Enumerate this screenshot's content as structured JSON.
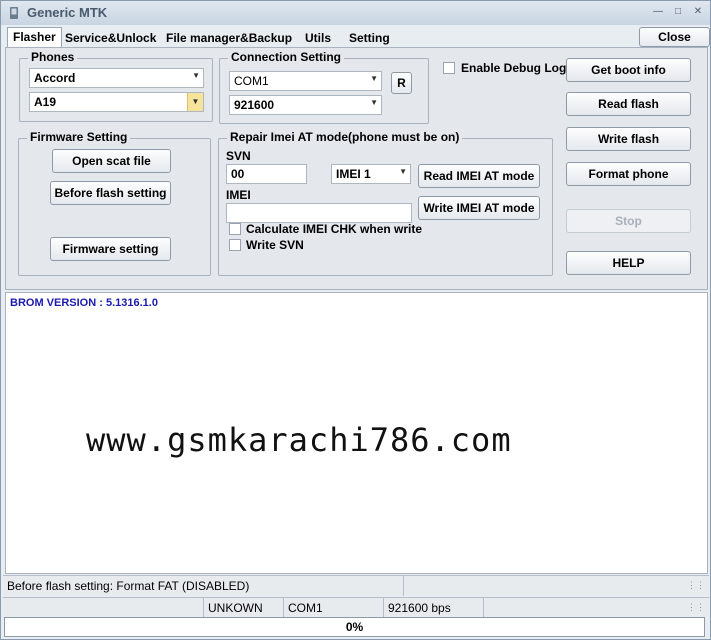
{
  "window": {
    "title": "Generic MTK"
  },
  "tabs": [
    {
      "label": "Flasher",
      "active": true
    },
    {
      "label": "Service&Unlock"
    },
    {
      "label": "File manager&Backup"
    },
    {
      "label": "Utils"
    },
    {
      "label": "Setting"
    }
  ],
  "close_label": "Close",
  "phones": {
    "title": "Phones",
    "brand": "Accord",
    "model": "A19"
  },
  "connection": {
    "title": "Connection Setting",
    "port": "COM1",
    "baud": "921600",
    "refresh_label": "R"
  },
  "debug": {
    "label": "Enable Debug Log",
    "checked": false
  },
  "firmware": {
    "title": "Firmware Setting",
    "open_scat": "Open scat file",
    "before_flash": "Before flash setting",
    "firmware_setting": "Firmware setting"
  },
  "imei": {
    "title": "Repair Imei AT mode(phone must be on)",
    "svn_label": "SVN",
    "svn_value": "00",
    "slot": "IMEI 1",
    "read_btn": "Read IMEI AT mode",
    "imei_label": "IMEI",
    "imei_value": "",
    "write_btn": "Write IMEI AT mode",
    "calc_chk": "Calculate IMEI CHK when write",
    "write_svn": "Write SVN"
  },
  "actions": {
    "get_boot": "Get boot info",
    "read_flash": "Read flash",
    "write_flash": "Write flash",
    "format_phone": "Format phone",
    "stop": "Stop",
    "help": "HELP"
  },
  "log": {
    "line1": "BROM VERSION : 5.1316.1.0",
    "watermark": "www.gsmkarachi786.com"
  },
  "status": {
    "message": "Before flash setting: Format FAT (DISABLED)",
    "device": "UNKOWN",
    "port": "COM1",
    "speed": "921600 bps",
    "progress_text": "0%",
    "progress": 0
  },
  "colors": {
    "log_text": "#1a1ab0",
    "accent_combo": "#f6e49a"
  }
}
